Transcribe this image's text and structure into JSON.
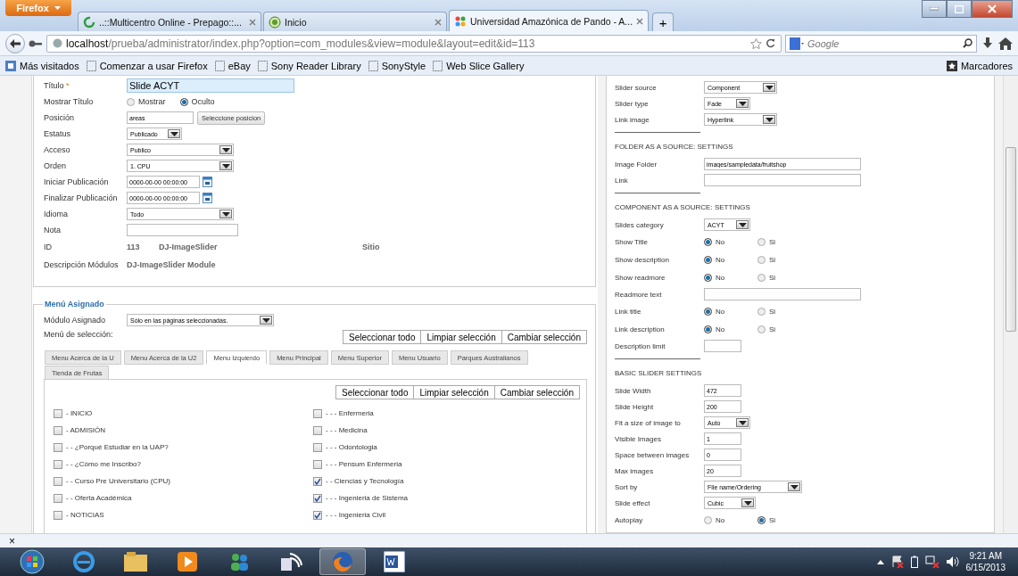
{
  "browser": {
    "menu_button": "Firefox",
    "tabs": [
      {
        "title": "..::Multicentro Online - Prepago::...",
        "selected": false,
        "kind": "spinner"
      },
      {
        "title": "Inicio",
        "selected": false,
        "kind": "globe"
      },
      {
        "title": "Universidad Amazónica de Pando - A...",
        "selected": true,
        "kind": "joomla"
      }
    ],
    "new_tab": "+",
    "url_host": "localhost",
    "url_path": "/prueba/administrator/index.php?option=com_modules&view=module&layout=edit&id=113",
    "search_placeholder": "Google",
    "bookmarks": [
      {
        "title": "Más visitados",
        "kind": "special"
      },
      {
        "title": "Comenzar a usar Firefox",
        "kind": "page"
      },
      {
        "title": "eBay",
        "kind": "page"
      },
      {
        "title": "Sony Reader Library",
        "kind": "page"
      },
      {
        "title": "SonyStyle",
        "kind": "page"
      },
      {
        "title": "Web Slice Gallery",
        "kind": "page"
      }
    ],
    "bookmarks_menu": "Marcadores"
  },
  "details": {
    "fields": [
      {
        "kind": "text",
        "label": "Título",
        "required_mark": "*",
        "value": "Slide ACYT"
      },
      {
        "kind": "radio",
        "label": "Mostrar Título",
        "options": [
          {
            "label": "Mostrar",
            "selected": false
          },
          {
            "label": "Oculto",
            "selected": true
          }
        ]
      },
      {
        "kind": "position",
        "label": "Posición",
        "value": "areas",
        "button": "Seleccione posicion"
      },
      {
        "kind": "select",
        "label": "Estatus",
        "value": "Publicado"
      },
      {
        "kind": "select",
        "label": "Acceso",
        "value": "Publico"
      },
      {
        "kind": "select",
        "label": "Orden",
        "value": "1. CPU"
      },
      {
        "kind": "date",
        "label": "Iniciar Publicación",
        "value": "0000-00-00 00:00:00"
      },
      {
        "kind": "date",
        "label": "Finalizar Publicación",
        "value": "0000-00-00 00:00:00"
      },
      {
        "kind": "select",
        "label": "Idioma",
        "value": "Todo"
      },
      {
        "kind": "text",
        "label": "Nota"
      },
      {
        "kind": "info",
        "label": "ID",
        "values": [
          "113",
          "DJ-ImageSlider",
          "Sitio"
        ]
      },
      {
        "kind": "info",
        "label": "Descripción Módulos",
        "values": [
          "DJ-ImageSlider Module"
        ]
      }
    ]
  },
  "menu_assignment": {
    "legend": "Menú Asignado",
    "module_label": "Módulo Asignado",
    "module_value": "Sólo en las páginas seleccionadas.",
    "selection_label": "Menú de selección:",
    "buttons": [
      "Seleccionar todo",
      "Limpiar selección",
      "Cambiar selección"
    ],
    "tabs": [
      {
        "label": "Menu Acerca de la U",
        "selected": false
      },
      {
        "label": "Menu Acerca de la U2",
        "selected": false
      },
      {
        "label": "Menu Izquierdo",
        "selected": true
      },
      {
        "label": "Menu Principal",
        "selected": false
      },
      {
        "label": "Menu Superior",
        "selected": false
      },
      {
        "label": "Menu Usuario",
        "selected": false
      },
      {
        "label": "Parques Australianos",
        "selected": false
      },
      {
        "label": "Tienda de Frutas",
        "selected": false
      }
    ],
    "tab_buttons": [
      "Seleccionar todo",
      "Limpiar selección",
      "Cambiar selección"
    ],
    "items": [
      {
        "label": "- INICIO",
        "checked": false
      },
      {
        "label": "- ADMISIÓN",
        "checked": false
      },
      {
        "label": "- - ¿Porqué Estudiar en la UAP?",
        "checked": false
      },
      {
        "label": "- - ¿Cómo me Inscribo?",
        "checked": false
      },
      {
        "label": "- - Curso Pre Universitario (CPU)",
        "checked": false
      },
      {
        "label": "- - Oferta Académica",
        "checked": false
      },
      {
        "label": "- NOTICIAS",
        "checked": false
      },
      {
        "label": "- - - Enfermeria",
        "checked": false
      },
      {
        "label": "- - - Medicina",
        "checked": false
      },
      {
        "label": "- - - Odontologia",
        "checked": false
      },
      {
        "label": "- - - Pensum Enfermeria",
        "checked": false
      },
      {
        "label": "- - Ciencias y Tecnología",
        "checked": true
      },
      {
        "label": "- - - Ingenieria de Sistema",
        "checked": true
      },
      {
        "label": "- - - Ingenieria Civil",
        "checked": true
      }
    ]
  },
  "options": {
    "rows": [
      {
        "kind": "select",
        "label": "Slider source",
        "value": "Component"
      },
      {
        "kind": "select",
        "label": "Slider type",
        "value": "Fade"
      },
      {
        "kind": "select",
        "label": "Link image",
        "value": "Hyperlink"
      },
      {
        "kind": "rule"
      },
      {
        "kind": "heading",
        "label": "FOLDER AS A SOURCE: SETTINGS"
      },
      {
        "kind": "text",
        "label": "Image Folder",
        "value": "images/sampledata/fruitshop"
      },
      {
        "kind": "text",
        "label": "Link",
        "value": ""
      },
      {
        "kind": "rule"
      },
      {
        "kind": "heading",
        "label": "COMPONENT AS A SOURCE: SETTINGS"
      },
      {
        "kind": "select",
        "label": "Slides category",
        "value": "ACYT"
      },
      {
        "kind": "radio",
        "label": "Show Title",
        "options": [
          {
            "label": "No",
            "selected": true
          },
          {
            "label": "Si",
            "selected": false
          }
        ]
      },
      {
        "kind": "radio",
        "label": "Show description",
        "options": [
          {
            "label": "No",
            "selected": true
          },
          {
            "label": "Si",
            "selected": false
          }
        ]
      },
      {
        "kind": "radio",
        "label": "Show readmore",
        "options": [
          {
            "label": "No",
            "selected": true
          },
          {
            "label": "Si",
            "selected": false
          }
        ]
      },
      {
        "kind": "text",
        "label": "Readmore text",
        "value": ""
      },
      {
        "kind": "radio",
        "label": "Link title",
        "options": [
          {
            "label": "No",
            "selected": true
          },
          {
            "label": "Si",
            "selected": false
          }
        ]
      },
      {
        "kind": "radio",
        "label": "Link description",
        "options": [
          {
            "label": "No",
            "selected": true
          },
          {
            "label": "Si",
            "selected": false
          }
        ]
      },
      {
        "kind": "number",
        "label": "Description limit",
        "value": ""
      },
      {
        "kind": "rule"
      },
      {
        "kind": "heading",
        "label": "BASIC SLIDER SETTINGS"
      },
      {
        "kind": "number",
        "label": "Slide Width",
        "value": "472"
      },
      {
        "kind": "number",
        "label": "Slide Height",
        "value": "200"
      },
      {
        "kind": "select",
        "label": "Fit a size of image to",
        "value": "Auto"
      },
      {
        "kind": "number",
        "label": "Visible Images",
        "value": "1"
      },
      {
        "kind": "number",
        "label": "Space between images",
        "value": "0"
      },
      {
        "kind": "number",
        "label": "Max images",
        "value": "20"
      },
      {
        "kind": "select",
        "label": "Sort by",
        "value": "File name/Ordering"
      },
      {
        "kind": "select",
        "label": "Slide effect",
        "value": "Cubic"
      },
      {
        "kind": "radio",
        "label": "Autoplay",
        "options": [
          {
            "label": "No",
            "selected": false
          },
          {
            "label": "Si",
            "selected": true
          }
        ]
      }
    ]
  },
  "find_bar": {
    "close": "×"
  },
  "taskbar": {
    "time": "9:21 AM",
    "date": "6/15/2013"
  }
}
